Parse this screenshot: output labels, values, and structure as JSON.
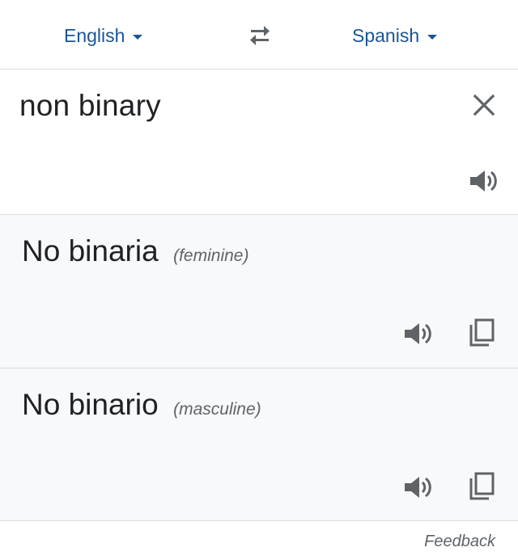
{
  "language_bar": {
    "source_language": "English",
    "target_language": "Spanish"
  },
  "input": {
    "text": "non binary"
  },
  "results": [
    {
      "text": "No binaria",
      "gender": "(feminine)"
    },
    {
      "text": "No binario",
      "gender": "(masculine)"
    }
  ],
  "footer": {
    "feedback_label": "Feedback"
  },
  "icons": {
    "swap": "swap-arrows-icon",
    "dropdown": "caret-down-icon",
    "clear": "close-icon",
    "listen": "speaker-icon",
    "copy": "copy-icon"
  },
  "colors": {
    "accent": "#1a5594",
    "icon": "#5f6368",
    "result_bg": "#f8f9fa",
    "divider": "#dadce0"
  }
}
